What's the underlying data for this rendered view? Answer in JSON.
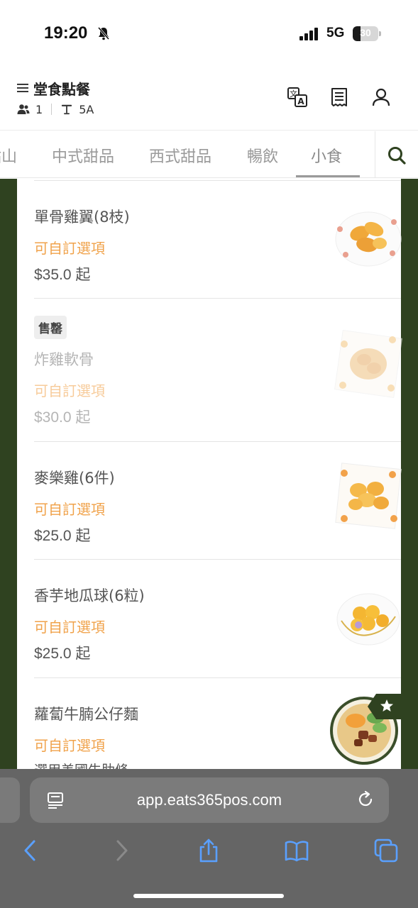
{
  "status": {
    "time": "19:20",
    "network": "5G",
    "battery": "30",
    "battery_level": 0.3,
    "icons": [
      "bell-slash-icon",
      "signal-icon",
      "battery-icon"
    ]
  },
  "header": {
    "title": "堂食點餐",
    "guest_count": "1",
    "table": "5A",
    "icons": [
      "menu-icon",
      "guests-icon",
      "table-icon",
      "translate-icon",
      "receipt-icon",
      "user-icon"
    ]
  },
  "tabs": {
    "items": [
      "點山",
      "中式甜品",
      "西式甜品",
      "暢飲",
      "小食"
    ],
    "active": "小食"
  },
  "menu_items": [
    {
      "name": "單骨雞翼(8枝)",
      "option": "可自訂選項",
      "price": "$35.0 起",
      "sold_out": false
    },
    {
      "badge": "售罄",
      "name": "炸雞軟骨",
      "option": "可自訂選項",
      "price": "$30.0 起",
      "sold_out": true
    },
    {
      "name": "麥樂雞(6件)",
      "option": "可自訂選項",
      "price": "$25.0 起",
      "sold_out": false
    },
    {
      "name": "香芋地瓜球(6粒)",
      "option": "可自訂選項",
      "price": "$25.0 起",
      "sold_out": false
    },
    {
      "name": "蘿蔔牛腩公仔麵",
      "option": "可自訂選項",
      "description": "選用美國牛肋條",
      "sold_out": false
    }
  ],
  "browser": {
    "url": "app.eats365pos.com",
    "icons": [
      "page-menu-icon",
      "reload-icon",
      "back-icon",
      "forward-icon",
      "share-icon",
      "bookmarks-icon",
      "tabs-icon"
    ]
  },
  "colors": {
    "brand_dark_green": "#2f4220",
    "accent_orange": "#f0a24a",
    "browser_gray": "#656565"
  }
}
